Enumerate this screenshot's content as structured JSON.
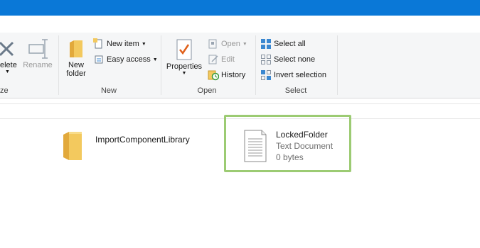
{
  "ribbon": {
    "organize": {
      "label": "ze",
      "delete_label": "elete",
      "rename_label": "Rename"
    },
    "new": {
      "label": "New",
      "new_folder_line1": "New",
      "new_folder_line2": "folder",
      "new_item_label": "New item",
      "easy_access_label": "Easy access"
    },
    "open": {
      "label": "Open",
      "properties_label": "Properties",
      "open_label": "Open",
      "edit_label": "Edit",
      "history_label": "History"
    },
    "select": {
      "label": "Select",
      "select_all_label": "Select all",
      "select_none_label": "Select none",
      "invert_selection_label": "Invert selection"
    }
  },
  "files": [
    {
      "name": "ImportComponentLibrary",
      "type_icon": "folder-icon"
    },
    {
      "name": "LockedFolder",
      "type": "Text Document",
      "size": "0 bytes",
      "type_icon": "text-document-icon"
    }
  ],
  "colors": {
    "titlebar": "#0a78d7",
    "highlight": "#9ccb73",
    "folder": "#f3c95e"
  }
}
